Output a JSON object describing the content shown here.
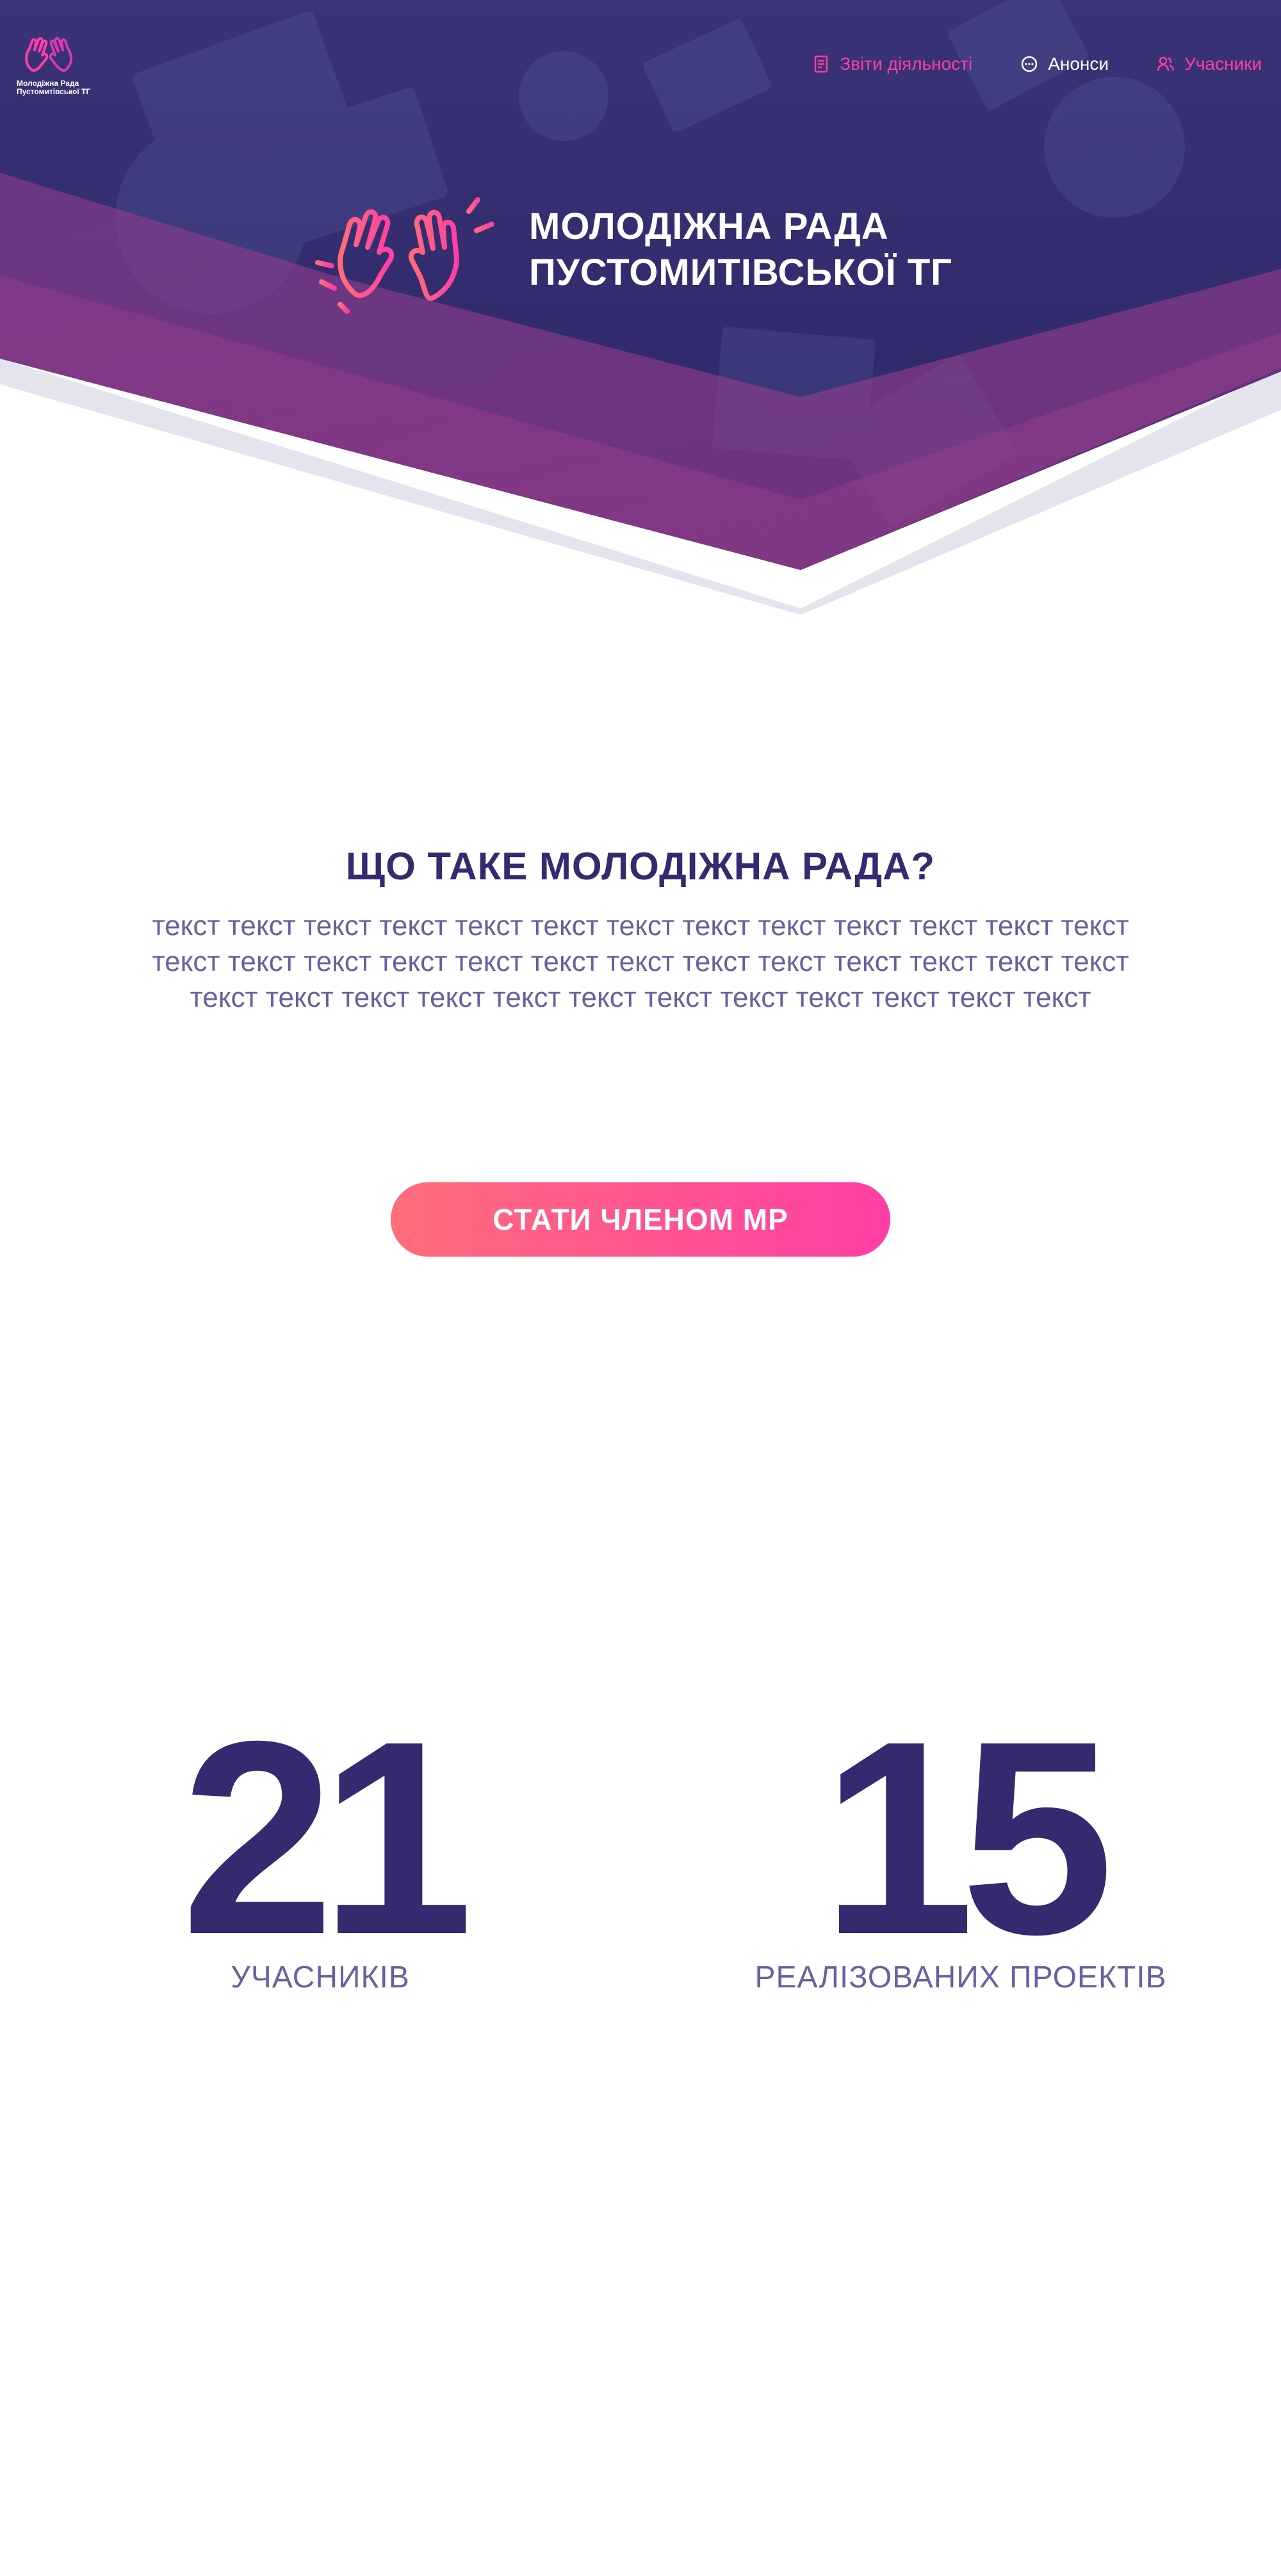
{
  "brand": {
    "mini_logo_text_line1": "Молодіжна Рада",
    "mini_logo_text_line2": "Пустомитівської ТГ",
    "title_line1": "МОЛОДІЖНА РАДА",
    "title_line2": "ПУСТОМИТІВСЬКОЇ ТГ"
  },
  "nav": {
    "items": [
      {
        "label": "Звіти діяльності",
        "icon": "document-icon",
        "color": "#ff3ea5"
      },
      {
        "label": "Анонси",
        "icon": "chat-bubble-icon",
        "color": "#ffffff"
      },
      {
        "label": "Учасники",
        "icon": "users-icon",
        "color": "#ff3ea5"
      }
    ]
  },
  "about": {
    "title": "ЩО ТАКЕ МОЛОДІЖНА РАДА?",
    "text": "текст текст текст текст текст текст текст текст текст текст текст текст текст текст текст текст текст текст текст текст текст текст текст текст текст текст текст текст текст текст текст текст текст текст текст текст текст текст"
  },
  "cta": {
    "label": "СТАТИ ЧЛЕНОМ МР"
  },
  "stats": [
    {
      "value": "21",
      "label": "УЧАСНИКІВ"
    },
    {
      "value": "15",
      "label": "РЕАЛІЗОВАНИХ ПРОЕКТІВ"
    }
  ],
  "colors": {
    "primary_dark": "#332a6f",
    "accent_pink": "#ff3ea5",
    "accent_coral": "#ff6d7a",
    "muted_text": "#6a5f9f",
    "hero_overlay": "#2f2a6b"
  }
}
